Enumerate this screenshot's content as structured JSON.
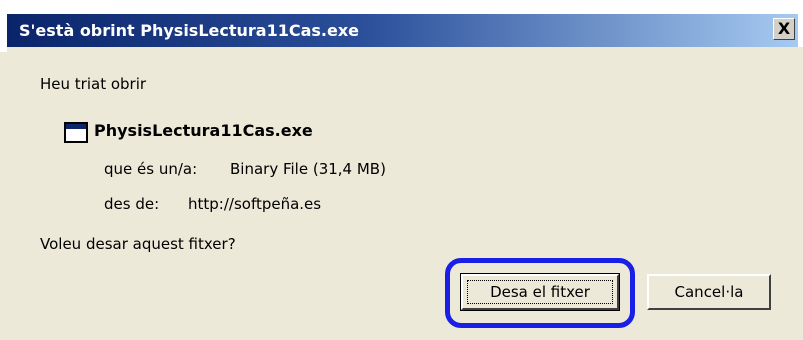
{
  "window": {
    "title": "S'està obrint PhysisLectura11Cas.exe",
    "close_label": "X"
  },
  "dialog": {
    "intro": "Heu triat obrir",
    "file_name": "PhysisLectura11Cas.exe",
    "type_label": "que és un/a:",
    "type_value": "Binary File (31,4 MB)",
    "from_label": "des de:",
    "from_value": "http://softpeña.es",
    "question": "Voleu desar aquest fitxer?"
  },
  "buttons": {
    "save_label": "Desa el fitxer",
    "cancel_label": "Cancel·la"
  },
  "icons": {
    "file": "application-window-icon",
    "close": "close-icon"
  },
  "colors": {
    "titlebar_start": "#0a246a",
    "titlebar_end": "#a6caf0",
    "dialog_bg": "#ece9d8",
    "highlight": "#1a1fe6"
  }
}
